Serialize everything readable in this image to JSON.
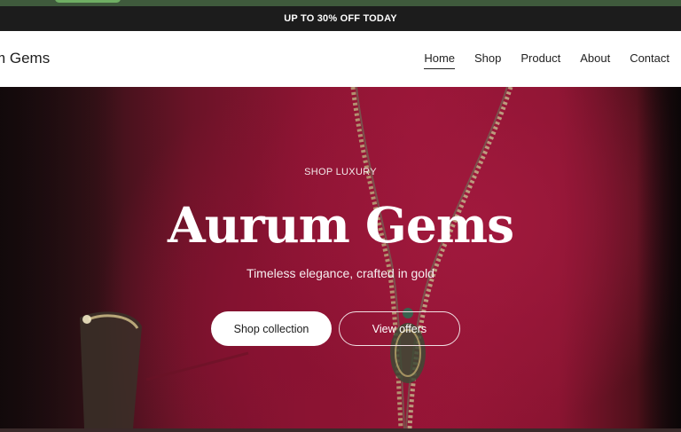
{
  "announcement": {
    "text": "UP TO 30% OFF TODAY"
  },
  "header": {
    "brand": "m Gems",
    "nav": [
      {
        "label": "Home",
        "active": true
      },
      {
        "label": "Shop",
        "active": false
      },
      {
        "label": "Product",
        "active": false
      },
      {
        "label": "About",
        "active": false
      },
      {
        "label": "Contact",
        "active": false
      }
    ]
  },
  "hero": {
    "eyebrow": "SHOP LUXURY",
    "title": "Aurum Gems",
    "subtitle": "Timeless elegance, crafted in gold",
    "primary_cta": "Shop collection",
    "secondary_cta": "View offers"
  },
  "colors": {
    "announcement_bg": "#1c1c1c",
    "hero_accent": "#981537",
    "top_strip": "#3f5a3c"
  }
}
